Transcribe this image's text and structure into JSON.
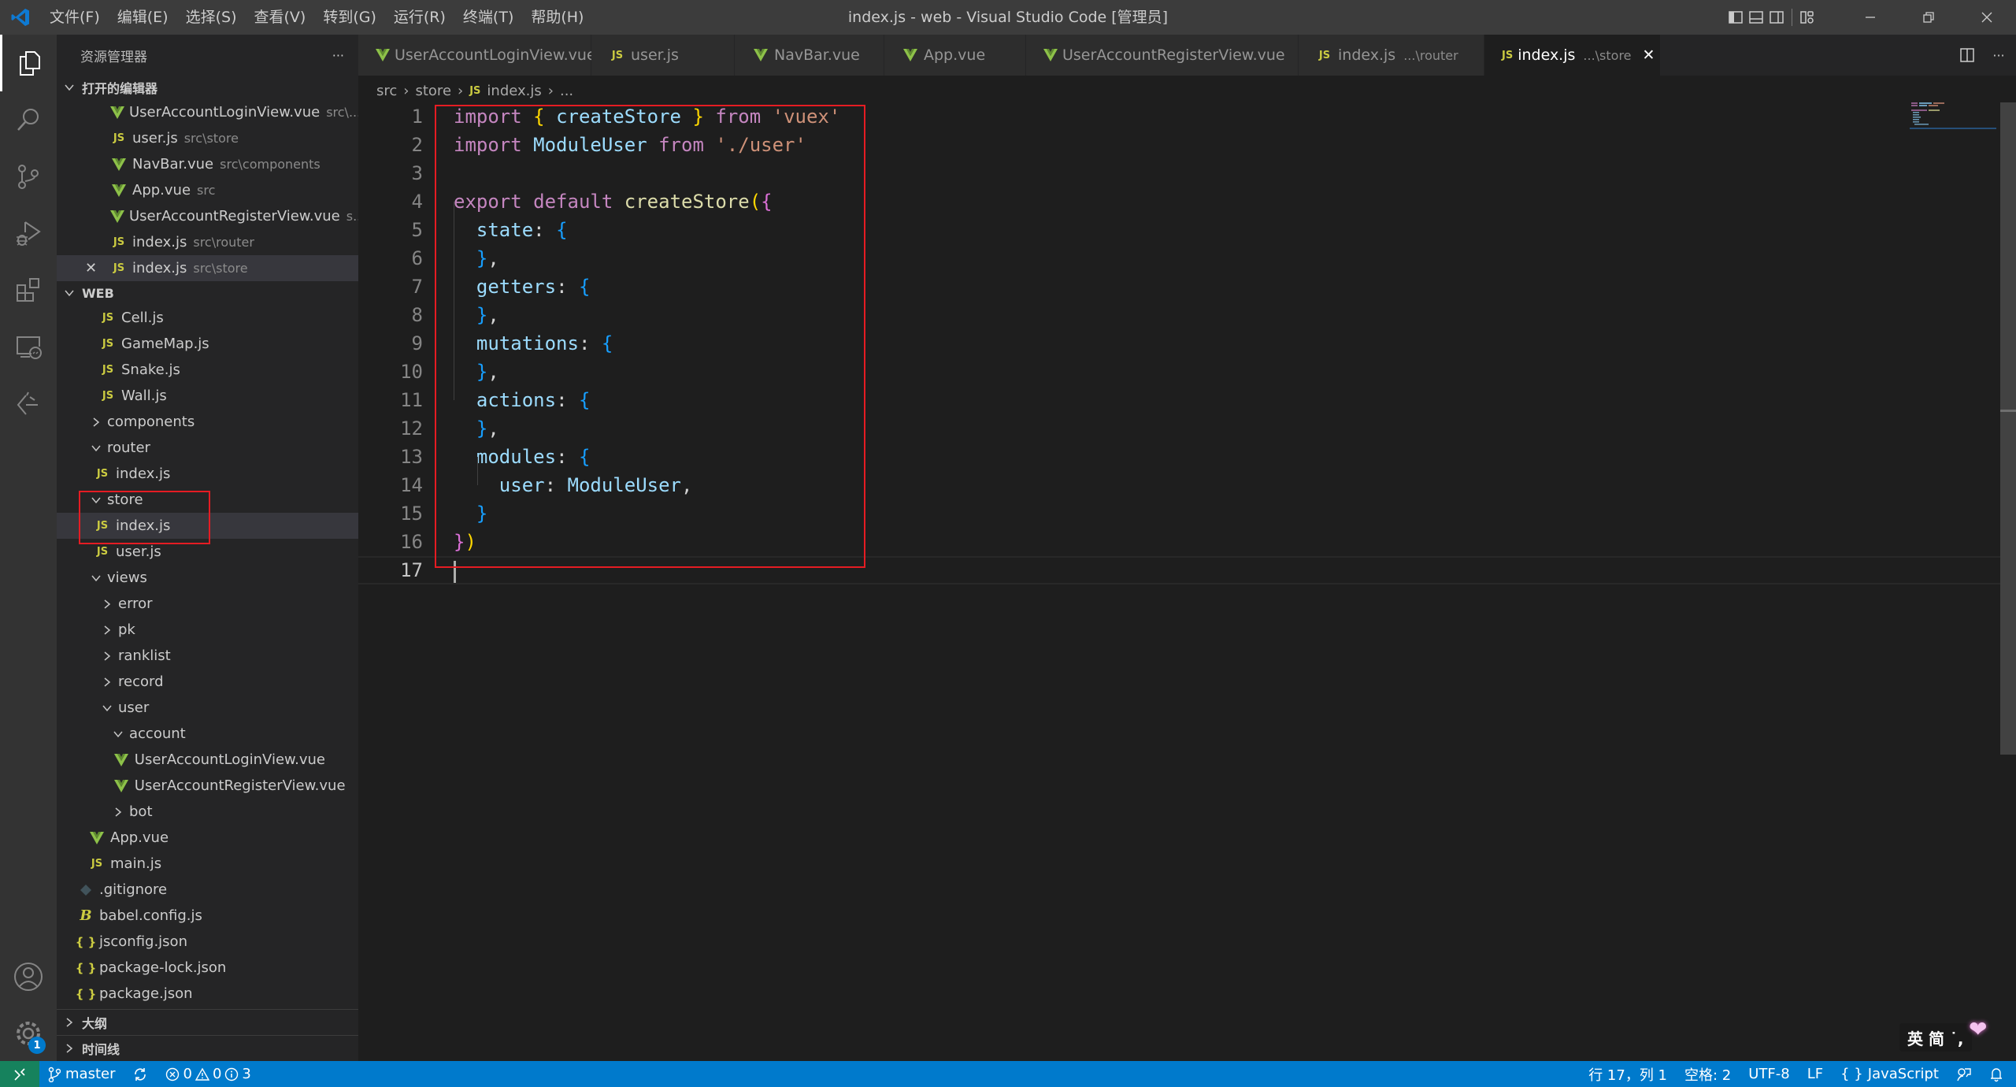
{
  "titlebar": {
    "menu": [
      "文件(F)",
      "编辑(E)",
      "选择(S)",
      "查看(V)",
      "转到(G)",
      "运行(R)",
      "终端(T)",
      "帮助(H)"
    ],
    "title": "index.js - web - Visual Studio Code [管理员]"
  },
  "sidebar": {
    "title": "资源管理器",
    "more": "···",
    "open_editors": {
      "label": "打开的编辑器",
      "items": [
        {
          "icon": "vue",
          "name": "UserAccountLoginView.vue",
          "desc": "src\\..."
        },
        {
          "icon": "js",
          "name": "user.js",
          "desc": "src\\store"
        },
        {
          "icon": "vue",
          "name": "NavBar.vue",
          "desc": "src\\components"
        },
        {
          "icon": "vue",
          "name": "App.vue",
          "desc": "src"
        },
        {
          "icon": "vue",
          "name": "UserAccountRegisterView.vue",
          "desc": "s..."
        },
        {
          "icon": "js",
          "name": "index.js",
          "desc": "src\\router"
        },
        {
          "icon": "js",
          "name": "index.js",
          "desc": "src\\store",
          "active": true
        }
      ]
    },
    "workspace": {
      "label": "WEB",
      "tree": [
        {
          "type": "file",
          "icon": "js",
          "name": "Cell.js",
          "indent": 3
        },
        {
          "type": "file",
          "icon": "js",
          "name": "GameMap.js",
          "indent": 3
        },
        {
          "type": "file",
          "icon": "js",
          "name": "Snake.js",
          "indent": 3
        },
        {
          "type": "file",
          "icon": "js",
          "name": "Wall.js",
          "indent": 3
        },
        {
          "type": "folder",
          "open": false,
          "name": "components",
          "indent": 2
        },
        {
          "type": "folder",
          "open": true,
          "name": "router",
          "indent": 2
        },
        {
          "type": "file",
          "icon": "js",
          "name": "index.js",
          "indent": 2.5
        },
        {
          "type": "folder",
          "open": true,
          "name": "store",
          "indent": 2
        },
        {
          "type": "file",
          "icon": "js",
          "name": "index.js",
          "indent": 2.5,
          "selected": true
        },
        {
          "type": "file",
          "icon": "js",
          "name": "user.js",
          "indent": 2.5
        },
        {
          "type": "folder",
          "open": true,
          "name": "views",
          "indent": 2
        },
        {
          "type": "folder",
          "open": false,
          "name": "error",
          "indent": 3
        },
        {
          "type": "folder",
          "open": false,
          "name": "pk",
          "indent": 3
        },
        {
          "type": "folder",
          "open": false,
          "name": "ranklist",
          "indent": 3
        },
        {
          "type": "folder",
          "open": false,
          "name": "record",
          "indent": 3
        },
        {
          "type": "folder",
          "open": true,
          "name": "user",
          "indent": 3
        },
        {
          "type": "folder",
          "open": true,
          "name": "account",
          "indent": 4
        },
        {
          "type": "file",
          "icon": "vue",
          "name": "UserAccountLoginView.vue",
          "indent": 4.2
        },
        {
          "type": "file",
          "icon": "vue",
          "name": "UserAccountRegisterView.vue",
          "indent": 4.2
        },
        {
          "type": "folder",
          "open": false,
          "name": "bot",
          "indent": 4
        },
        {
          "type": "file",
          "icon": "vue",
          "name": "App.vue",
          "indent": 2
        },
        {
          "type": "file",
          "icon": "js",
          "name": "main.js",
          "indent": 2
        },
        {
          "type": "file",
          "icon": "git",
          "name": ".gitignore",
          "indent": 1
        },
        {
          "type": "file",
          "icon": "babel",
          "name": "babel.config.js",
          "indent": 1
        },
        {
          "type": "file",
          "icon": "json",
          "name": "jsconfig.json",
          "indent": 1
        },
        {
          "type": "file",
          "icon": "json",
          "name": "package-lock.json",
          "indent": 1
        },
        {
          "type": "file",
          "icon": "json",
          "name": "package.json",
          "indent": 1
        }
      ]
    },
    "outline_label": "大纲",
    "timeline_label": "时间线"
  },
  "tabs": [
    {
      "icon": "vue",
      "name": "UserAccountLoginView.vue",
      "desc": ""
    },
    {
      "icon": "js",
      "name": "user.js",
      "desc": ""
    },
    {
      "icon": "vue",
      "name": "NavBar.vue",
      "desc": ""
    },
    {
      "icon": "vue",
      "name": "App.vue",
      "desc": ""
    },
    {
      "icon": "vue",
      "name": "UserAccountRegisterView.vue",
      "desc": ""
    },
    {
      "icon": "js",
      "name": "index.js",
      "desc": "...\\router"
    },
    {
      "icon": "js",
      "name": "index.js",
      "desc": "...\\store",
      "active": true
    }
  ],
  "breadcrumb": [
    "src",
    "store",
    "index.js",
    "..."
  ],
  "editor": {
    "current_line": 17,
    "lines": [
      [
        [
          "kw",
          "import"
        ],
        [
          "punc",
          " "
        ],
        [
          "br1",
          "{"
        ],
        [
          "punc",
          " "
        ],
        [
          "id",
          "createStore"
        ],
        [
          "punc",
          " "
        ],
        [
          "br1",
          "}"
        ],
        [
          "punc",
          " "
        ],
        [
          "kw",
          "from"
        ],
        [
          "punc",
          " "
        ],
        [
          "str",
          "'vuex'"
        ]
      ],
      [
        [
          "kw",
          "import"
        ],
        [
          "punc",
          " "
        ],
        [
          "id",
          "ModuleUser"
        ],
        [
          "punc",
          " "
        ],
        [
          "kw",
          "from"
        ],
        [
          "punc",
          " "
        ],
        [
          "str",
          "'./user'"
        ]
      ],
      [],
      [
        [
          "kw",
          "export"
        ],
        [
          "punc",
          " "
        ],
        [
          "kw",
          "default"
        ],
        [
          "punc",
          " "
        ],
        [
          "fn",
          "createStore"
        ],
        [
          "br1",
          "("
        ],
        [
          "br2",
          "{"
        ]
      ],
      [
        [
          "punc",
          "  "
        ],
        [
          "id",
          "state"
        ],
        [
          "punc",
          ": "
        ],
        [
          "br3",
          "{"
        ]
      ],
      [
        [
          "punc",
          "  "
        ],
        [
          "br3",
          "}"
        ],
        [
          "punc",
          ","
        ]
      ],
      [
        [
          "punc",
          "  "
        ],
        [
          "id",
          "getters"
        ],
        [
          "punc",
          ": "
        ],
        [
          "br3",
          "{"
        ]
      ],
      [
        [
          "punc",
          "  "
        ],
        [
          "br3",
          "}"
        ],
        [
          "punc",
          ","
        ]
      ],
      [
        [
          "punc",
          "  "
        ],
        [
          "id",
          "mutations"
        ],
        [
          "punc",
          ": "
        ],
        [
          "br3",
          "{"
        ]
      ],
      [
        [
          "punc",
          "  "
        ],
        [
          "br3",
          "}"
        ],
        [
          "punc",
          ","
        ]
      ],
      [
        [
          "punc",
          "  "
        ],
        [
          "id",
          "actions"
        ],
        [
          "punc",
          ": "
        ],
        [
          "br3",
          "{"
        ]
      ],
      [
        [
          "punc",
          "  "
        ],
        [
          "br3",
          "}"
        ],
        [
          "punc",
          ","
        ]
      ],
      [
        [
          "punc",
          "  "
        ],
        [
          "id",
          "modules"
        ],
        [
          "punc",
          ": "
        ],
        [
          "br3",
          "{"
        ]
      ],
      [
        [
          "punc",
          "    "
        ],
        [
          "id",
          "user"
        ],
        [
          "punc",
          ": "
        ],
        [
          "id",
          "ModuleUser"
        ],
        [
          "punc",
          ","
        ]
      ],
      [
        [
          "punc",
          "  "
        ],
        [
          "br3",
          "}"
        ]
      ],
      [
        [
          "br2",
          "}"
        ],
        [
          "br1",
          ")"
        ]
      ],
      []
    ]
  },
  "ime": {
    "text": "英 简 ˙,"
  },
  "statusbar": {
    "branch": "master",
    "errors": "0",
    "warnings": "0",
    "infos": "3",
    "position": "行 17，列 1",
    "indent": "空格: 2",
    "encoding": "UTF-8",
    "eol": "LF",
    "language": "JavaScript",
    "settings_badge": "1"
  },
  "colors": {
    "accent": "#007acc",
    "remote": "#16825d",
    "highlight_box": "#e51c23",
    "vue": "#8dc149",
    "js": "#cbcb41"
  }
}
